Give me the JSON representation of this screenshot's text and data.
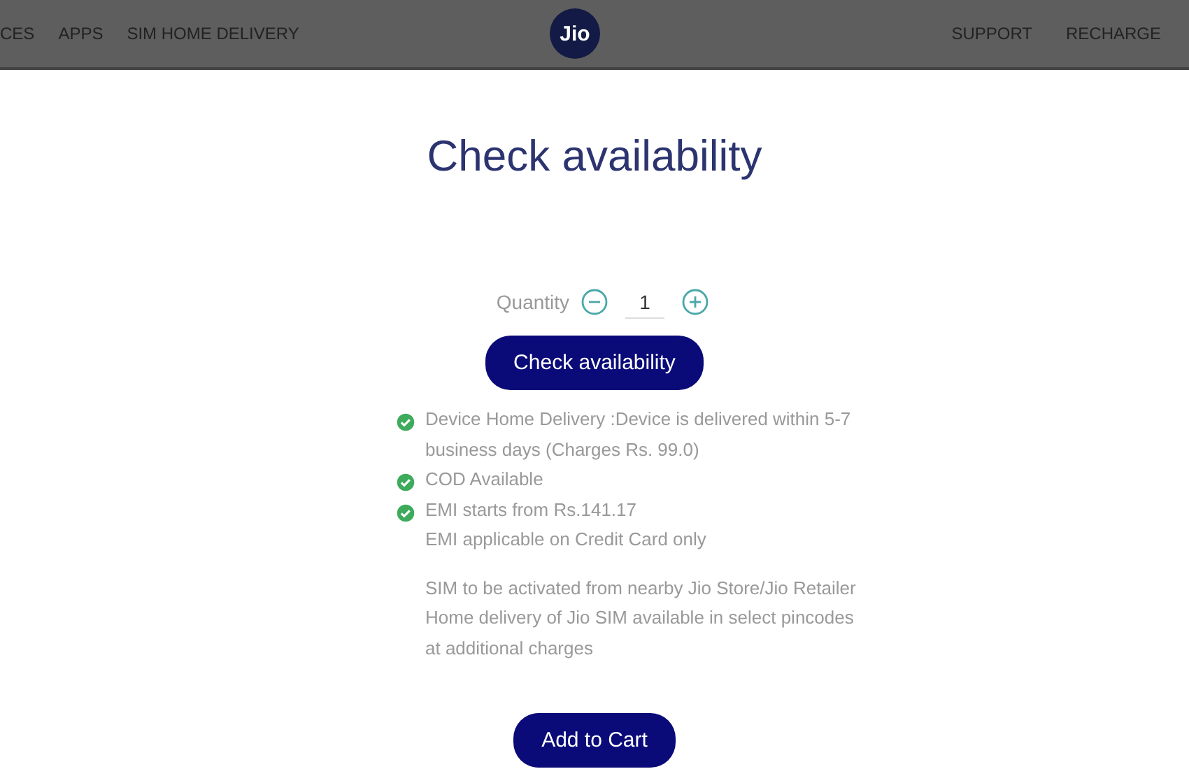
{
  "nav": {
    "left": [
      "CES",
      "APPS",
      "SIM HOME DELIVERY"
    ],
    "logo": "Jio",
    "right": [
      "SUPPORT",
      "RECHARGE"
    ]
  },
  "title": "Check availability",
  "quantity": {
    "label": "Quantity",
    "value": "1"
  },
  "check_button": "Check availability",
  "features": [
    {
      "text": "Device Home Delivery :Device is delivered within 5-7 business days (Charges Rs. 99.0)",
      "checked": true
    },
    {
      "text": "COD Available",
      "checked": true
    },
    {
      "text": "EMI starts from Rs.141.17",
      "checked": true
    },
    {
      "text": "EMI applicable on Credit Card only",
      "checked": false
    }
  ],
  "note": [
    "SIM to be activated from nearby Jio Store/Jio Retailer",
    "Home delivery of Jio SIM available in select pincodes",
    "at additional charges"
  ],
  "cart_button": "Add to Cart"
}
